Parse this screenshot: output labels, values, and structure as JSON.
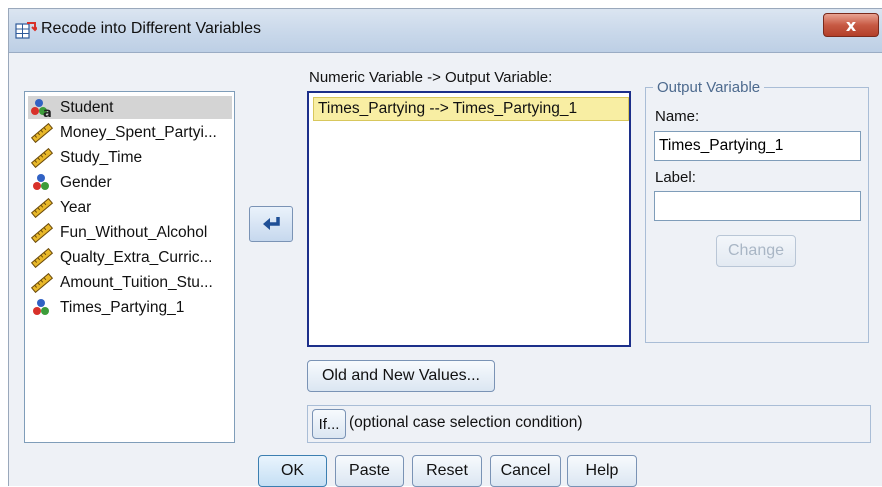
{
  "window": {
    "title": "Recode into Different Variables",
    "close_label": "x"
  },
  "variables": [
    {
      "label": "Student",
      "icon": "nominal-string-icon",
      "selected": true
    },
    {
      "label": "Money_Spent_Partyi...",
      "icon": "scale-ruler-icon"
    },
    {
      "label": "Study_Time",
      "icon": "scale-ruler-icon"
    },
    {
      "label": "Gender",
      "icon": "nominal-icon"
    },
    {
      "label": "Year",
      "icon": "scale-ruler-icon"
    },
    {
      "label": "Fun_Without_Alcohol",
      "icon": "scale-ruler-icon"
    },
    {
      "label": "Qualty_Extra_Curric...",
      "icon": "scale-ruler-icon"
    },
    {
      "label": "Amount_Tuition_Stu...",
      "icon": "scale-ruler-icon"
    },
    {
      "label": "Times_Partying_1",
      "icon": "nominal-icon"
    }
  ],
  "numeric_output": {
    "caption": "Numeric Variable -> Output Variable:",
    "items": [
      "Times_Partying --> Times_Partying_1"
    ]
  },
  "output_variable": {
    "legend": "Output Variable",
    "name_label": "Name:",
    "name_value": "Times_Partying_1",
    "label_label": "Label:",
    "label_value": "",
    "change_label": "Change"
  },
  "old_new_values_label": "Old and New Values...",
  "if_section": {
    "button_label": "If...",
    "caption": "(optional case selection condition)"
  },
  "buttons": {
    "ok": "OK",
    "paste": "Paste",
    "reset": "Reset",
    "cancel": "Cancel",
    "help": "Help"
  },
  "colors": {
    "selection_highlight": "#f8eea3",
    "scale_icon": "#d9a520",
    "nominal_red": "#d8312a",
    "nominal_green": "#3c9c3a",
    "nominal_blue": "#3162c4"
  }
}
